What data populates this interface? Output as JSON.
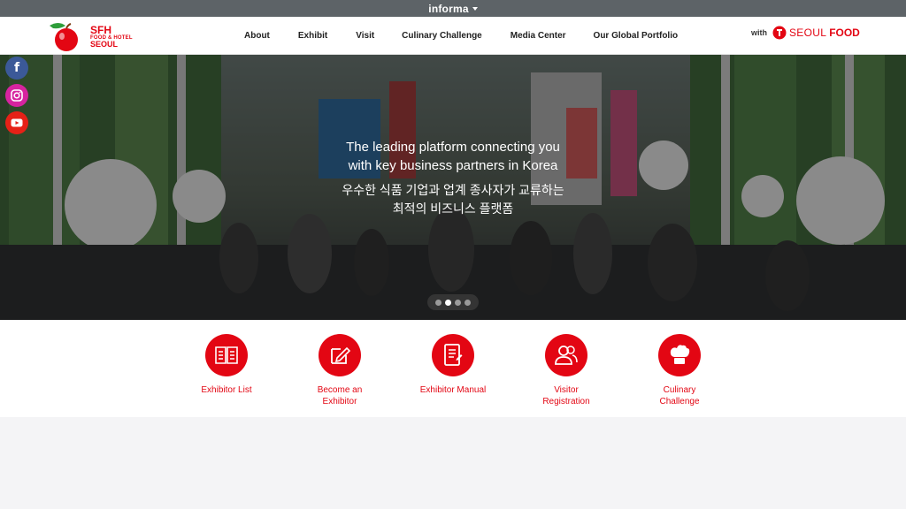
{
  "topbar": {
    "brand": "informa"
  },
  "logo": {
    "line1": "SFH",
    "line2": "FOOD & HOTEL",
    "line3": "SEOUL"
  },
  "nav": {
    "items": [
      "About",
      "Exhibit",
      "Visit",
      "Culinary Challenge",
      "Media Center",
      "Our Global Portfolio"
    ]
  },
  "partner": {
    "with": "with",
    "seoul": "SEOUL",
    "food": "FOOD"
  },
  "social": {
    "facebook": "f",
    "instagram_icon": "instagram-icon",
    "youtube_icon": "youtube-icon"
  },
  "hero": {
    "line_en_1": "The leading platform connecting you",
    "line_en_2": "with key business partners in Korea",
    "line_ko_1": "우수한 식품 기업과 업계 종사자가 교류하는",
    "line_ko_2": "최적의 비즈니스 플랫폼",
    "slides_total": 4,
    "slide_active": 2
  },
  "quick_links": [
    {
      "label_1": "Exhibitor List",
      "label_2": "",
      "icon": "book-icon"
    },
    {
      "label_1": "Become an",
      "label_2": "Exhibitor",
      "icon": "edit-icon"
    },
    {
      "label_1": "Exhibitor Manual",
      "label_2": "",
      "icon": "document-icon"
    },
    {
      "label_1": "Visitor",
      "label_2": "Registration",
      "icon": "users-icon"
    },
    {
      "label_1": "Culinary",
      "label_2": "Challenge",
      "icon": "chef-hat-icon"
    }
  ],
  "colors": {
    "brand_red": "#e30613",
    "topbar": "#5d6367",
    "footer_bg": "#f4f4f6"
  }
}
